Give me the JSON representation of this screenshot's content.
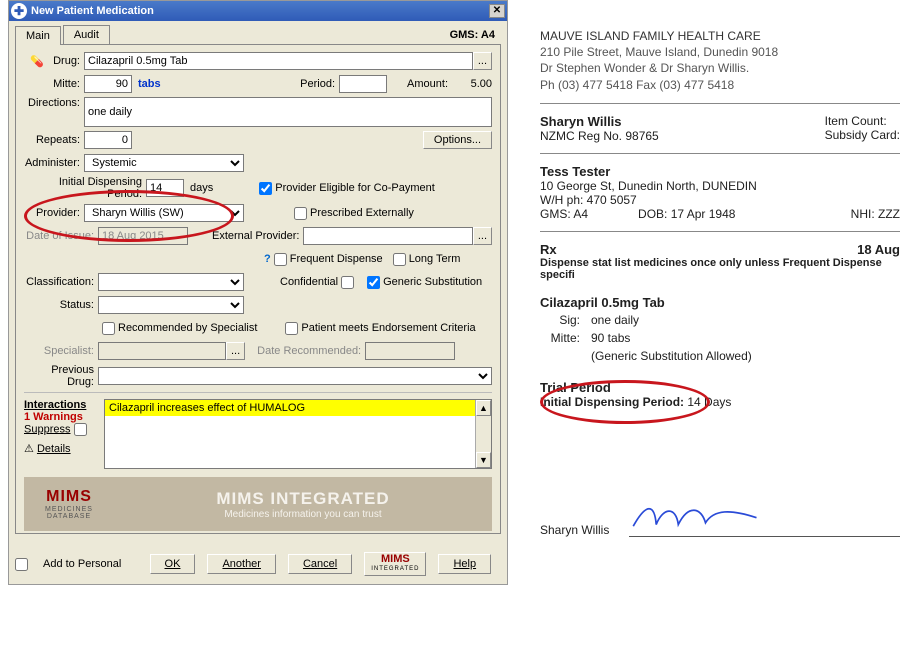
{
  "window": {
    "title": "New Patient Medication",
    "tabs": {
      "main": "Main",
      "audit": "Audit"
    },
    "gms_label": "GMS: A4"
  },
  "form": {
    "drug_label": "Drug:",
    "drug_value": "Cilazapril 0.5mg Tab",
    "mitte_label": "Mitte:",
    "mitte_value": "90",
    "mitte_unit": "tabs",
    "period_label": "Period:",
    "period_value": "",
    "amount_label": "Amount:",
    "amount_value": "5.00",
    "directions_label": "Directions:",
    "directions_value": "one daily",
    "repeats_label": "Repeats:",
    "repeats_value": "0",
    "options_label": "Options...",
    "administer_label": "Administer:",
    "administer_value": "Systemic",
    "idp_label": "Initial Dispensing Period:",
    "idp_value": "14",
    "idp_unit": "days",
    "copay_label": "Provider Eligible for Co-Payment",
    "provider_label": "Provider:",
    "provider_value": "Sharyn Willis (SW)",
    "prescribed_ext_label": "Prescribed Externally",
    "doi_label": "Date of Issue:",
    "doi_value": "18 Aug 2015",
    "ext_provider_label": "External Provider:",
    "ext_provider_value": "",
    "freq_dispense_label": "Frequent Dispense",
    "long_term_label": "Long Term",
    "classification_label": "Classification:",
    "classification_value": "",
    "confidential_label": "Confidential",
    "generic_sub_label": "Generic Substitution",
    "status_label": "Status:",
    "status_value": "",
    "rec_spec_label": "Recommended by Specialist",
    "endorse_label": "Patient meets Endorsement Criteria",
    "specialist_label": "Specialist:",
    "specialist_value": "",
    "date_rec_label": "Date Recommended:",
    "date_rec_value": "",
    "prev_drug_label": "Previous Drug:",
    "prev_drug_value": ""
  },
  "interactions": {
    "header": "Interactions",
    "warnings": "1 Warnings",
    "suppress": "Suppress",
    "details": "Details",
    "line": "Cilazapril increases effect of HUMALOG"
  },
  "mims": {
    "brand": "MIMS",
    "sub1": "MEDICINES",
    "sub2": "DATABASE",
    "banner_title": "MIMS INTEGRATED",
    "banner_sub": "Medicines information you can trust"
  },
  "bottom": {
    "add_personal": "Add to Personal",
    "ok": "OK",
    "another": "Another",
    "cancel": "Cancel",
    "mims": "MIMS",
    "mims_sub": "INTEGRATED",
    "help": "Help"
  },
  "rx": {
    "clinic_name": "MAUVE ISLAND FAMILY HEALTH CARE",
    "clinic_addr": "210 Pile Street, Mauve Island, Dunedin 9018",
    "clinic_docs": "Dr Stephen Wonder & Dr Sharyn Willis.",
    "clinic_phone": "Ph (03) 477 5418 Fax (03) 477 5418",
    "prescriber": "Sharyn Willis",
    "reg": "NZMC Reg No. 98765",
    "item_count_lbl": "Item Count:",
    "subsidy_lbl": "Subsidy Card:",
    "patient": "Tess Tester",
    "pat_addr": "10 George St, Dunedin North, DUNEDIN",
    "pat_phone": "W/H ph: 470 5057",
    "gms": "GMS: A4",
    "dob": "DOB: 17 Apr 1948",
    "nhi": "NHI: ZZZ",
    "rx_lbl": "Rx",
    "rx_date": "18 Aug",
    "dispense_note": "Dispense stat list medicines once only unless Frequent Dispense specifi",
    "drug": "Cilazapril 0.5mg Tab",
    "sig_lbl": "Sig:",
    "sig_val": "one daily",
    "mitte_lbl": "Mitte:",
    "mitte_val": "90 tabs",
    "generic": "(Generic Substitution Allowed)",
    "trial_hdr": "Trial Period",
    "trial_line_lbl": "Initial Dispensing Period:",
    "trial_line_val": " 14 Days",
    "sig_name": "Sharyn Willis"
  }
}
